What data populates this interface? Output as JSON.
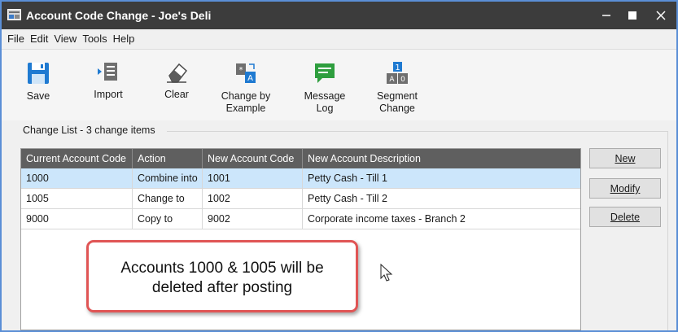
{
  "window": {
    "title": "Account Code Change - Joe's Deli",
    "controls": {
      "minimize_icon": "minimize-icon",
      "maximize_icon": "maximize-icon",
      "close_icon": "close-icon"
    }
  },
  "menu": [
    "File",
    "Edit",
    "View",
    "Tools",
    "Help"
  ],
  "toolbar": {
    "save": {
      "label": "Save",
      "icon": "save-icon"
    },
    "import": {
      "label": "Import",
      "icon": "import-icon"
    },
    "clear": {
      "label": "Clear",
      "icon": "eraser-icon"
    },
    "change_by_example": {
      "line1": "Change by",
      "line2": "Example",
      "icon": "change-by-example-icon"
    },
    "message_log": {
      "line1": "Message",
      "line2": "Log",
      "icon": "message-log-icon"
    },
    "segment_change": {
      "line1": "Segment",
      "line2": "Change",
      "icon": "segment-change-icon"
    }
  },
  "change_list": {
    "group_label": "Change List - 3 change items",
    "columns": [
      "Current Account Code",
      "Action",
      "New Account Code",
      "New Account Description"
    ],
    "rows": [
      {
        "current": "1000",
        "action": "Combine into",
        "new_code": "1001",
        "description": "Petty Cash - Till 1",
        "selected": true
      },
      {
        "current": "1005",
        "action": "Change to",
        "new_code": "1002",
        "description": "Petty Cash - Till 2",
        "selected": false
      },
      {
        "current": "9000",
        "action": "Copy to",
        "new_code": "9002",
        "description": "Corporate income taxes - Branch 2",
        "selected": false
      }
    ]
  },
  "side_buttons": {
    "new": "New",
    "modify": "Modify",
    "delete": "Delete"
  },
  "callout": {
    "line1": "Accounts 1000 & 1005 will be",
    "line2": "deleted after posting"
  },
  "colors": {
    "title_bar": "#3c3c3c",
    "header": "#5f5f5f",
    "selected_row": "#cce6fb",
    "callout_border": "#e05555",
    "accent_blue": "#1f7ad1",
    "accent_green": "#2e9e3e"
  }
}
